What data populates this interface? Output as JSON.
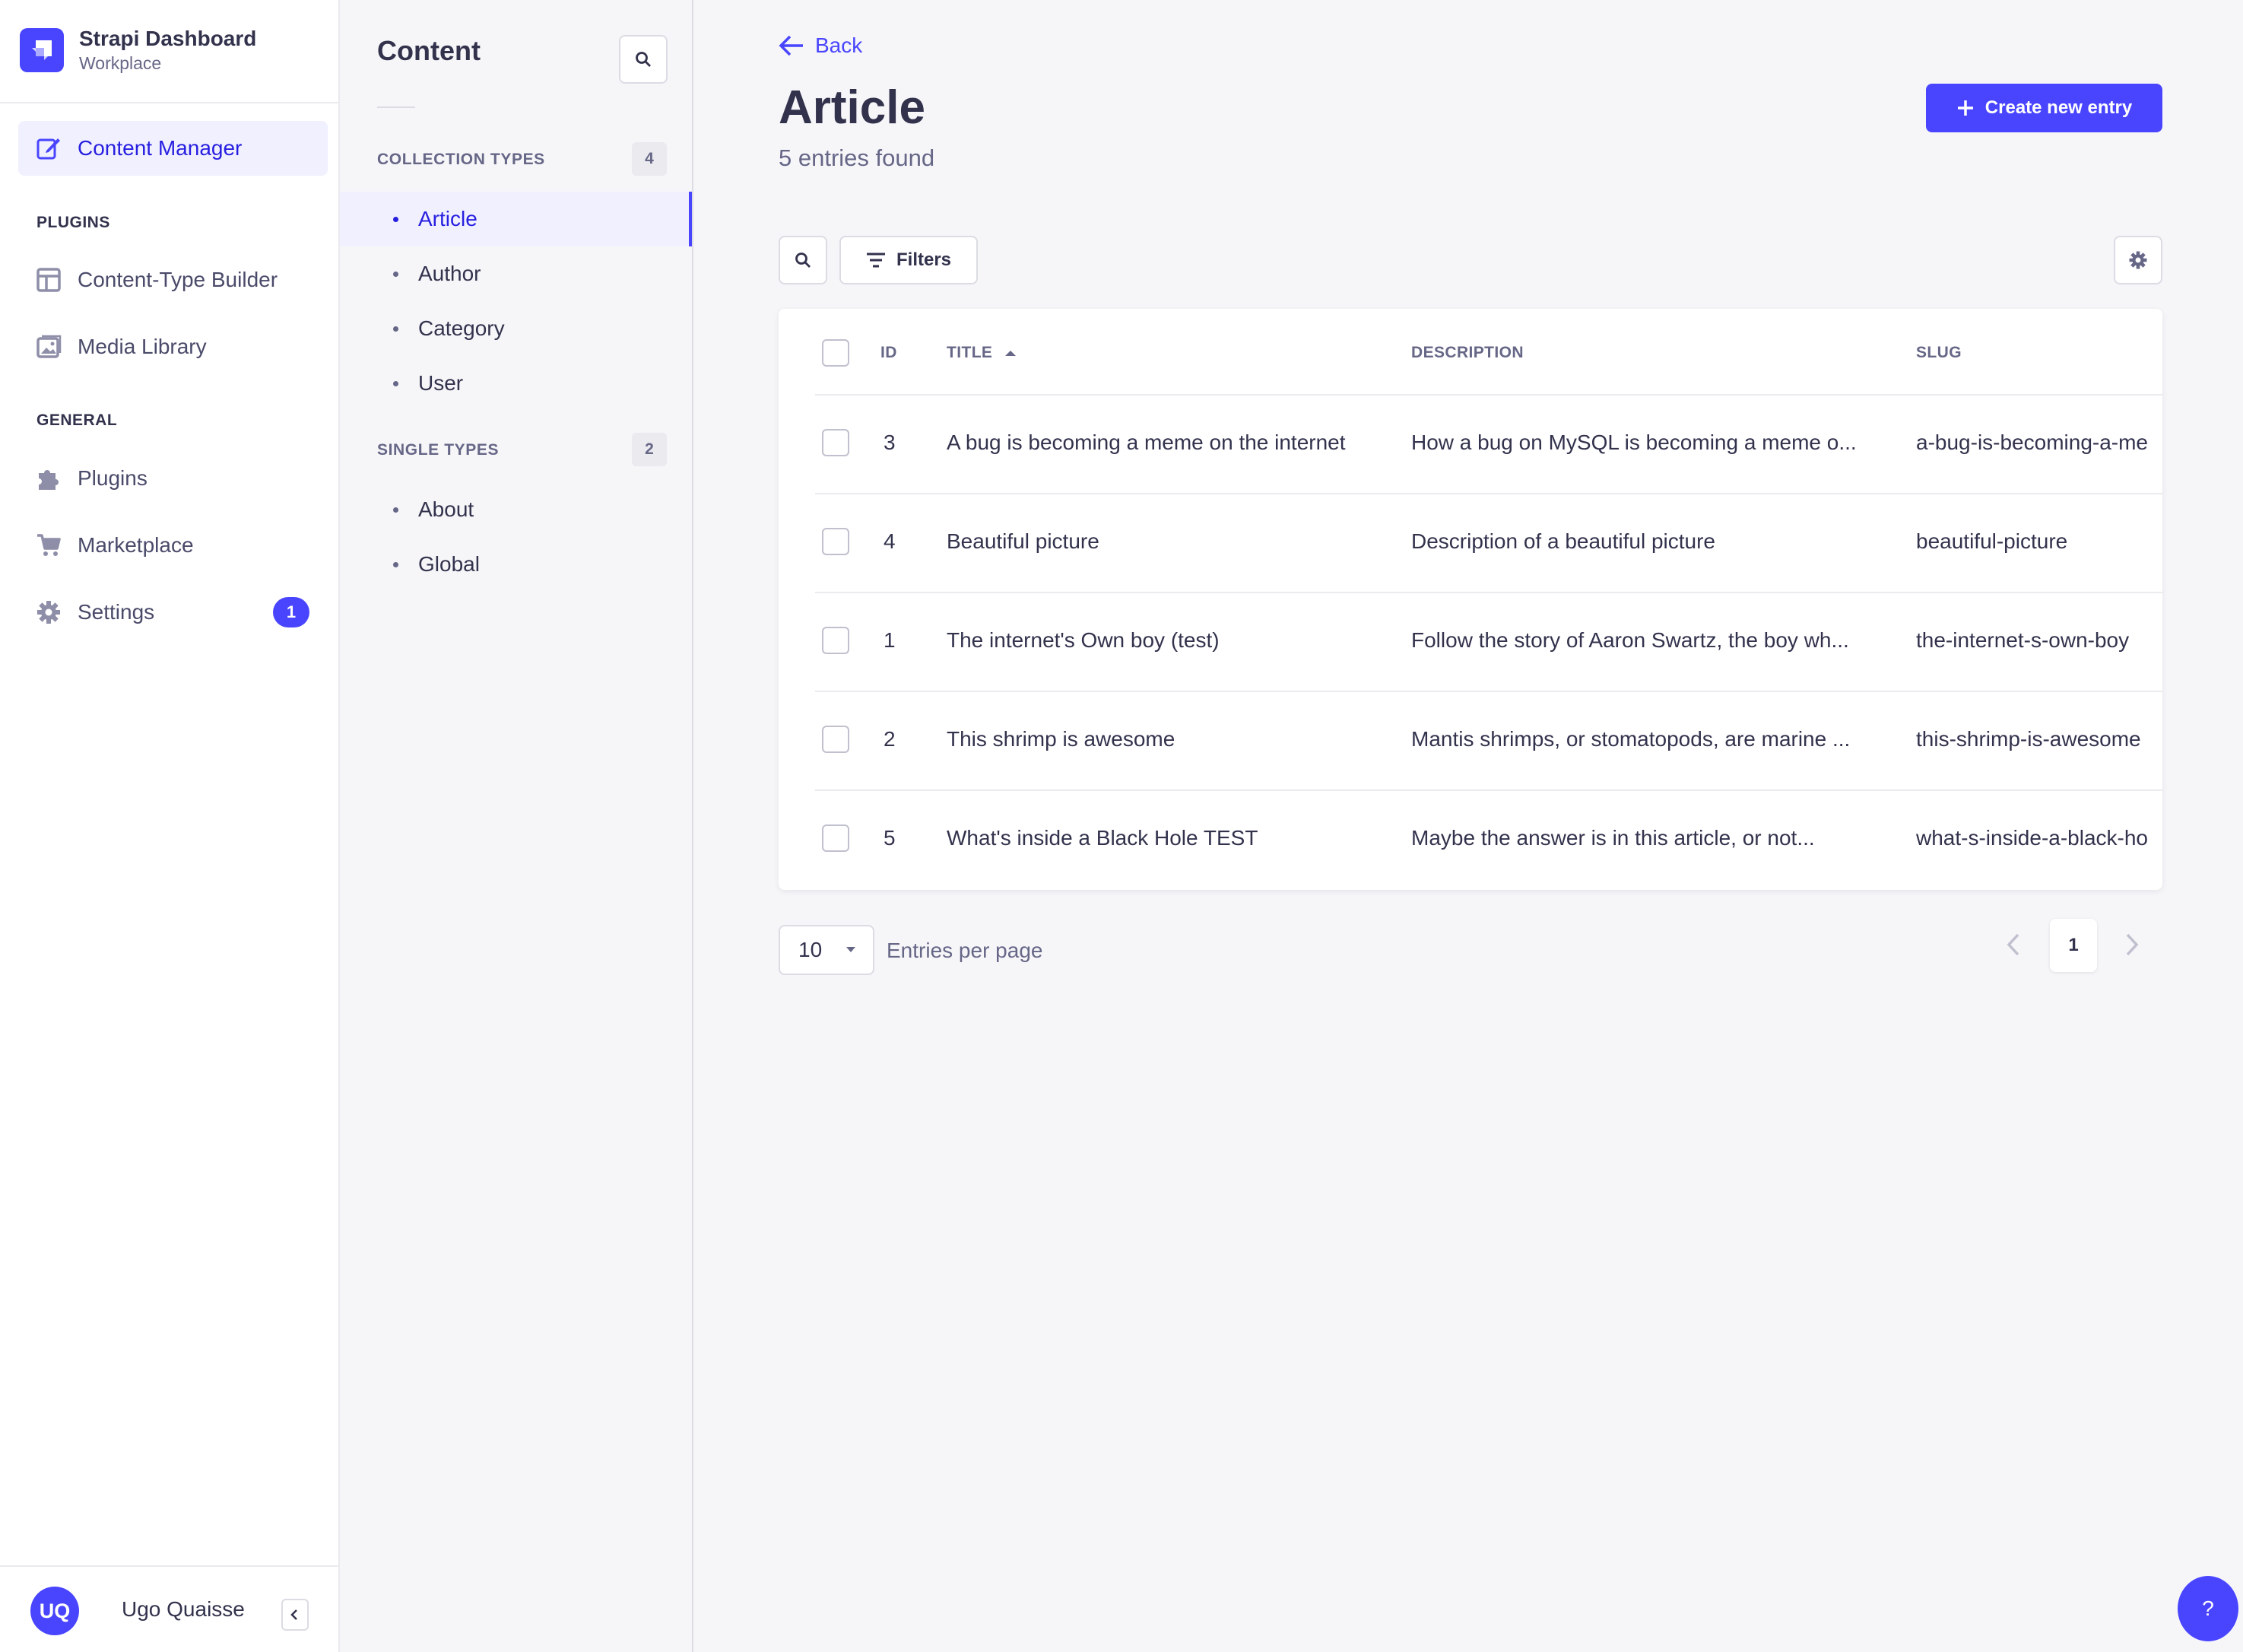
{
  "brand": {
    "title": "Strapi Dashboard",
    "subtitle": "Workplace",
    "logo_icon": "strapi-logo-icon",
    "color": "#4945ff"
  },
  "mainnav": {
    "content_manager": "Content Manager",
    "plugins_section": "PLUGINS",
    "content_type_builder": "Content-Type Builder",
    "media_library": "Media Library",
    "general_section": "GENERAL",
    "plugins": "Plugins",
    "marketplace": "Marketplace",
    "settings": "Settings",
    "settings_badge": "1"
  },
  "user": {
    "initials": "UQ",
    "name": "Ugo Quaisse"
  },
  "subnav": {
    "title": "Content",
    "collection_types_label": "COLLECTION TYPES",
    "collection_types_count": "4",
    "collection_types": [
      "Article",
      "Author",
      "Category",
      "User"
    ],
    "single_types_label": "SINGLE TYPES",
    "single_types_count": "2",
    "single_types": [
      "About",
      "Global"
    ],
    "active": "Article"
  },
  "header": {
    "back_label": "Back",
    "title": "Article",
    "subtitle": "5 entries found",
    "create_label": "Create new entry"
  },
  "toolbar": {
    "filters_label": "Filters"
  },
  "table": {
    "columns": {
      "id": "ID",
      "title": "TITLE",
      "description": "DESCRIPTION",
      "slug": "SLUG"
    },
    "sort": {
      "column": "TITLE",
      "direction": "ascending"
    },
    "rows": [
      {
        "id": "3",
        "title": "A bug is becoming a meme on the internet",
        "description": "How a bug on MySQL is becoming a meme o...",
        "slug": "a-bug-is-becoming-a-me"
      },
      {
        "id": "4",
        "title": "Beautiful picture",
        "description": "Description of a beautiful picture",
        "slug": "beautiful-picture"
      },
      {
        "id": "1",
        "title": "The internet's Own boy (test)",
        "description": "Follow the story of Aaron Swartz, the boy wh...",
        "slug": "the-internet-s-own-boy"
      },
      {
        "id": "2",
        "title": "This shrimp is awesome",
        "description": "Mantis shrimps, or stomatopods, are marine ...",
        "slug": "this-shrimp-is-awesome"
      },
      {
        "id": "5",
        "title": "What's inside a Black Hole TEST",
        "description": "Maybe the answer is in this article, or not...",
        "slug": "what-s-inside-a-black-ho"
      }
    ]
  },
  "pagination": {
    "per_page": "10",
    "per_page_label": "Entries per page",
    "current_page": "1"
  },
  "help": {
    "label": "?"
  }
}
